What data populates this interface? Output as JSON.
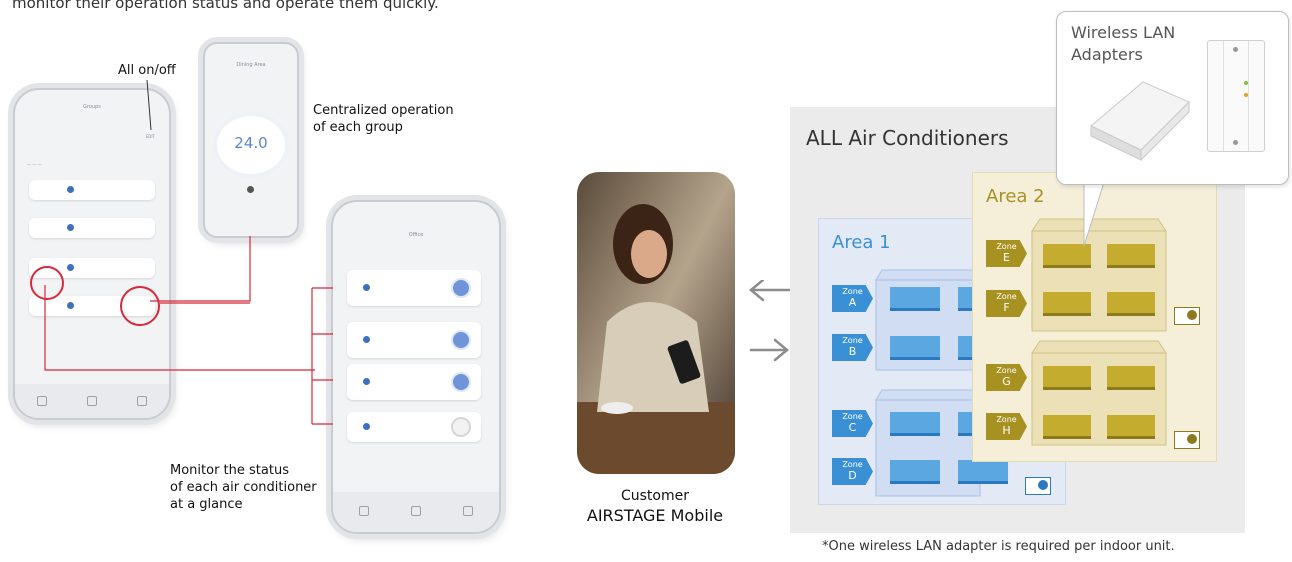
{
  "intro_text": "monitor their operation status and operate them quickly.",
  "phone_left": {
    "all_label": "All on/off",
    "screen_title": "Groups",
    "edit": "EDIT"
  },
  "phone_center": {
    "title": "Dining Area",
    "temperature": "24.0"
  },
  "phone_right": {
    "title": "Office"
  },
  "labels": {
    "centralized": "Centralized operation\nof each group",
    "monitor": "Monitor the status\nof each air conditioner\nat a glance"
  },
  "customer": {
    "line1": "Customer",
    "line2": "AIRSTAGE Mobile"
  },
  "diagram": {
    "title": "ALL Air Conditioners",
    "area1": "Area 1",
    "area2": "Area 2",
    "zone_word": "Zone",
    "zones_area1": [
      "A",
      "B",
      "C",
      "D"
    ],
    "zones_area2": [
      "E",
      "F",
      "G",
      "H"
    ],
    "adapter_title": "Wireless LAN\nAdapters",
    "footnote": "*One wireless LAN adapter is required per indoor unit."
  },
  "colors": {
    "accent_red": "#d8283a",
    "zone_blue": "#3a90d5",
    "zone_gold": "#a79121",
    "area1_bg": "#e3eaf6",
    "area2_bg": "#f5efd9"
  }
}
